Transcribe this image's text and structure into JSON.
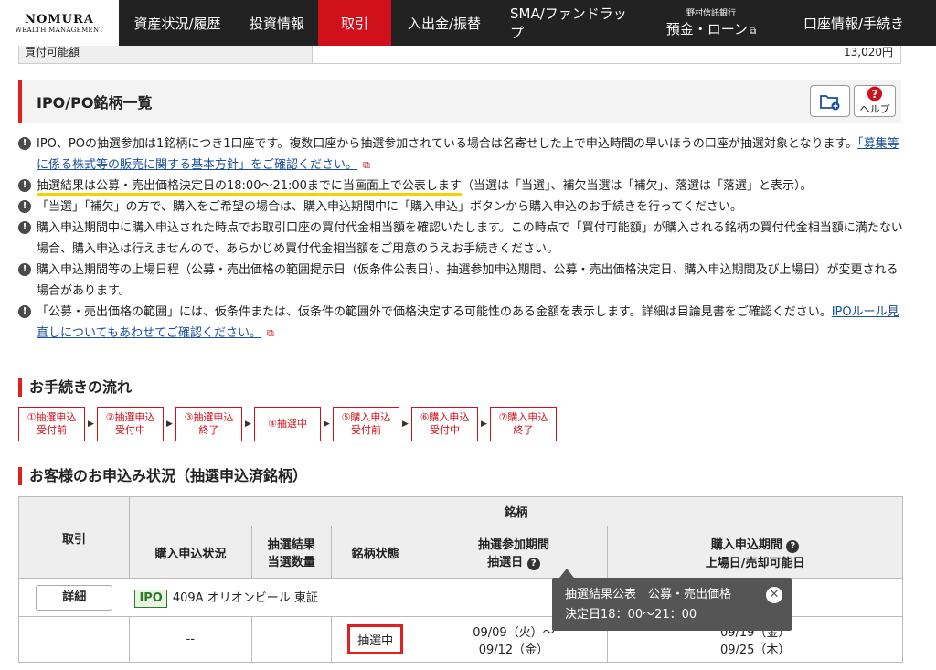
{
  "nav": {
    "logo_line1": "NOMURA",
    "logo_line2": "WEALTH MANAGEMENT",
    "items": [
      {
        "label": "資産状況/履歴"
      },
      {
        "label": "投資情報"
      },
      {
        "label": "取引"
      },
      {
        "label": "入出金/振替"
      },
      {
        "label": "SMA/ファンドラップ"
      },
      {
        "small": "野村信託銀行",
        "label": "預金・ローン"
      },
      {
        "label": "口座情報/手続き"
      }
    ]
  },
  "balance": {
    "label": "買付可能額",
    "value": "13,020円"
  },
  "page_title": "IPO/PO銘柄一覧",
  "title_buttons": {
    "help_label": "ヘルプ"
  },
  "notes": [
    {
      "text": "IPO、POの抽選参加は1銘柄につき1口座です。複数口座から抽選参加されている場合は名寄せした上で申込時間の早いほうの口座が抽選対象となります。",
      "link": "「募集等に係る株式等の販売に関する基本方針」をご確認ください。"
    },
    {
      "highlight": "抽選結果は公募・売出価格決定日の18:00〜21:00までに当画面上で公表します",
      "text": "（当選は「当選」、補欠当選は「補欠」、落選は「落選」と表示）。"
    },
    {
      "text": "「当選」「補欠」の方で、購入をご希望の場合は、購入申込期間中に「購入申込」ボタンから購入申込のお手続きを行ってください。"
    },
    {
      "text": "購入申込期間中に購入申込された時点でお取引口座の買付代金相当額を確認いたします。この時点で「買付可能額」が購入される銘柄の買付代金相当額に満たない場合、購入申込は行えませんので、あらかじめ買付代金相当額をご用意のうえお手続きください。"
    },
    {
      "text": "購入申込期間等の上場日程（公募・売出価格の範囲提示日（仮条件公表日）、抽選参加申込期間、公募・売出価格決定日、購入申込期間及び上場日）が変更される場合があります。"
    },
    {
      "text": "「公募・売出価格の範囲」には、仮条件または、仮条件の範囲外で価格決定する可能性のある金額を表示します。詳細は目論見書をご確認ください。",
      "link": "IPOルール見直しについてもあわせてご確認ください。"
    }
  ],
  "flow": {
    "title": "お手続きの流れ",
    "steps": [
      {
        "l1": "①抽選申込",
        "l2": "受付前"
      },
      {
        "l1": "②抽選申込",
        "l2": "受付中"
      },
      {
        "l1": "③抽選申込",
        "l2": "終了"
      },
      {
        "l1": "④抽選中",
        "l2": ""
      },
      {
        "l1": "⑤購入申込",
        "l2": "受付前"
      },
      {
        "l1": "⑥購入申込",
        "l2": "受付中"
      },
      {
        "l1": "⑦購入申込",
        "l2": "終了"
      }
    ]
  },
  "status_section": {
    "title": "お客様のお申込み状況（抽選申込済銘柄）",
    "headers": {
      "trade": "取引",
      "issue": "銘柄",
      "purchase_status": "購入申込状況",
      "lottery_result": "抽選結果",
      "winning_qty": "当選数量",
      "issue_status": "銘柄状態",
      "lottery_period": "抽選参加期間",
      "lottery_date": "抽選日",
      "purchase_period": "購入申込期間",
      "listing_date": "上場日/売却可能日"
    },
    "row": {
      "detail_btn": "詳細",
      "tag": "IPO",
      "issue_name": "409A オリオンビール 東証",
      "purchase_status": "--",
      "issue_status": "抽選中",
      "lottery_period": "09/09（火）〜",
      "lottery_date": "09/12（金）",
      "purchase_period": "09/19（金）",
      "listing_date": "09/25（木）"
    }
  },
  "tooltip": {
    "line1": "抽選結果公表　公募・売出価格",
    "line2": "決定日18：00〜21：00"
  }
}
